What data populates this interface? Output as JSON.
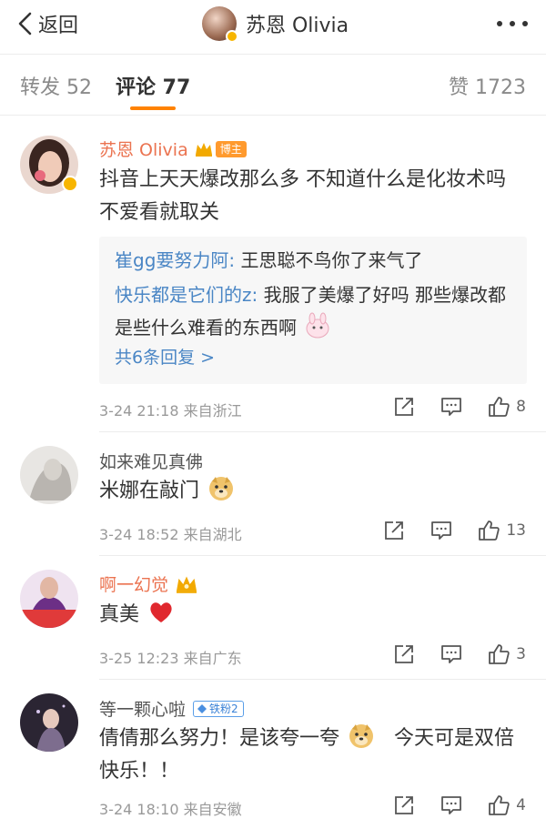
{
  "header": {
    "back_label": "返回",
    "title": "苏恩 Olivia"
  },
  "tabs": {
    "repost": "转发 52",
    "comments": "评论 77",
    "likes": "赞 1723"
  },
  "colors": {
    "accent": "#ff8200",
    "username_orange": "#eb7350",
    "link_blue": "#4a86c5"
  },
  "comments": [
    {
      "name": "苏恩 Olivia",
      "badge": "博主",
      "text": "抖音上天天爆改那么多 不知道什么是化妆术吗 不爱看就取关",
      "replies": [
        {
          "name": "崔gg要努力阿:",
          "text": " 王思聪不鸟你了来气了"
        },
        {
          "name": "快乐都是它们的z:",
          "text": " 我服了美爆了好吗 那些爆改都是些什么难看的东西啊"
        }
      ],
      "more_replies": "共6条回复 >",
      "meta": "3-24 21:18  来自浙江",
      "likes": "8"
    },
    {
      "name": "如来难见真佛",
      "text": "米娜在敲门",
      "meta": "3-24 18:52  来自湖北",
      "likes": "13"
    },
    {
      "name": "啊一幻觉",
      "text": "真美",
      "meta": "3-25 12:23  来自广东",
      "likes": "3"
    },
    {
      "name": "等一颗心啦",
      "badge": "铁粉2",
      "text": "倩倩那么努力！是该夸一夸",
      "text_extra": "今天可是双倍快乐！！",
      "meta": "3-24 18:10  来自安徽",
      "likes": "4"
    }
  ]
}
